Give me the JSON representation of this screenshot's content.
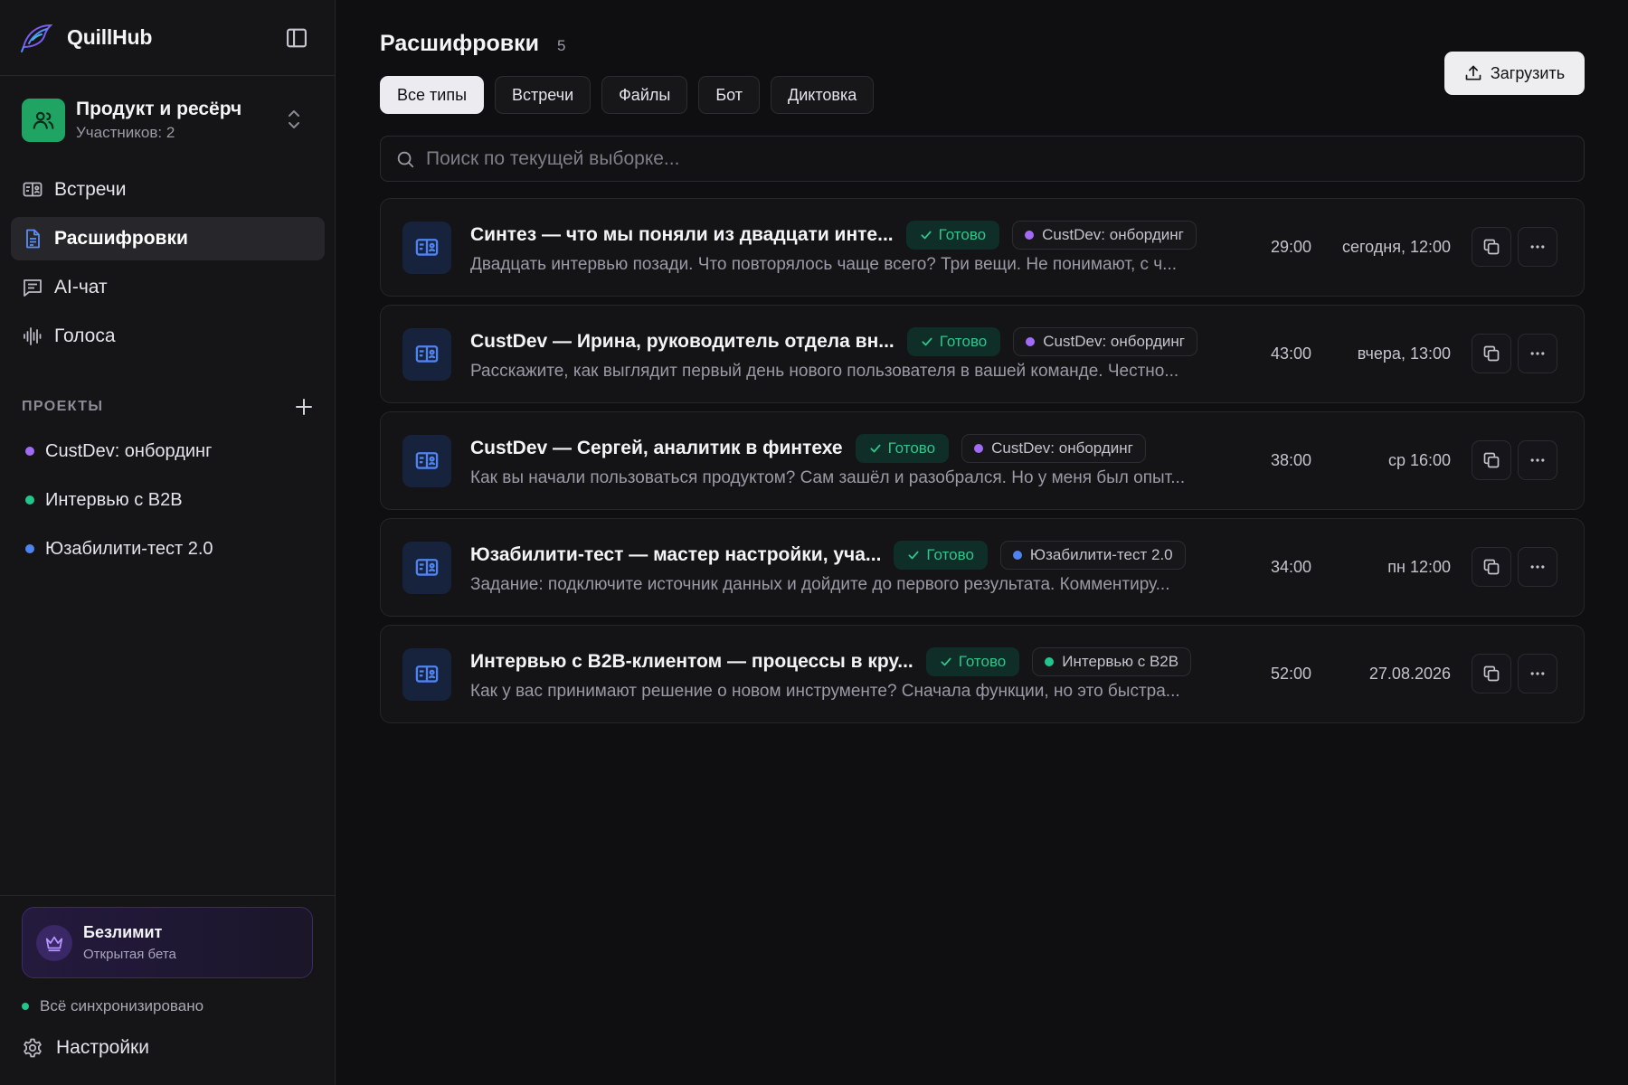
{
  "app": {
    "name": "QuillHub"
  },
  "workspace": {
    "name": "Продукт и ресёрч",
    "members": "Участников: 2"
  },
  "nav": [
    {
      "label": "Встречи",
      "icon": "meetings-icon"
    },
    {
      "label": "Расшифровки",
      "icon": "transcripts-icon",
      "active": true
    },
    {
      "label": "AI-чат",
      "icon": "chat-icon"
    },
    {
      "label": "Голоса",
      "icon": "voices-icon"
    }
  ],
  "projects": {
    "title": "ПРОЕКТЫ",
    "items": [
      {
        "label": "CustDev: онбординг",
        "color": "#a26bf5"
      },
      {
        "label": "Интервью с B2B",
        "color": "#22c58b"
      },
      {
        "label": "Юзабилити-тест 2.0",
        "color": "#4f83f1"
      }
    ]
  },
  "plan": {
    "title": "Безлимит",
    "subtitle": "Открытая бета"
  },
  "sync": {
    "label": "Всё синхронизировано",
    "color": "#22c58b"
  },
  "settings": {
    "label": "Настройки"
  },
  "page": {
    "title": "Расшифровки",
    "count": "5",
    "upload_label": "Загрузить"
  },
  "filters": [
    {
      "label": "Все типы",
      "active": true
    },
    {
      "label": "Встречи"
    },
    {
      "label": "Файлы"
    },
    {
      "label": "Бот"
    },
    {
      "label": "Диктовка"
    }
  ],
  "search": {
    "placeholder": "Поиск по текущей выборке..."
  },
  "transcripts": [
    {
      "title": "Синтез — что мы поняли из двадцати инте...",
      "status": "Готово",
      "project": "CustDev: онбординг",
      "project_color": "#a26bf5",
      "snippet": "Двадцать интервью позади. Что повторялось чаще всего? Три вещи. Не понимают, с ч...",
      "duration": "29:00",
      "date": "сегодня, 12:00"
    },
    {
      "title": "CustDev — Ирина, руководитель отдела вн...",
      "status": "Готово",
      "project": "CustDev: онбординг",
      "project_color": "#a26bf5",
      "snippet": "Расскажите, как выглядит первый день нового пользователя в вашей команде. Честно...",
      "duration": "43:00",
      "date": "вчера, 13:00"
    },
    {
      "title": "CustDev — Сергей, аналитик в финтехе",
      "status": "Готово",
      "project": "CustDev: онбординг",
      "project_color": "#a26bf5",
      "snippet": "Как вы начали пользоваться продуктом? Сам зашёл и разобрался. Но у меня был опыт...",
      "duration": "38:00",
      "date": "ср 16:00"
    },
    {
      "title": "Юзабилити-тест — мастер настройки, уча...",
      "status": "Готово",
      "project": "Юзабилити-тест 2.0",
      "project_color": "#4f83f1",
      "snippet": "Задание: подключите источник данных и дойдите до первого результата. Комментиру...",
      "duration": "34:00",
      "date": "пн 12:00"
    },
    {
      "title": "Интервью с B2B-клиентом — процессы в кру...",
      "status": "Готово",
      "project": "Интервью с B2B",
      "project_color": "#22c58b",
      "snippet": "Как у вас принимают решение о новом инструменте? Сначала функции, но это быстра...",
      "duration": "52:00",
      "date": "27.08.2026"
    }
  ]
}
